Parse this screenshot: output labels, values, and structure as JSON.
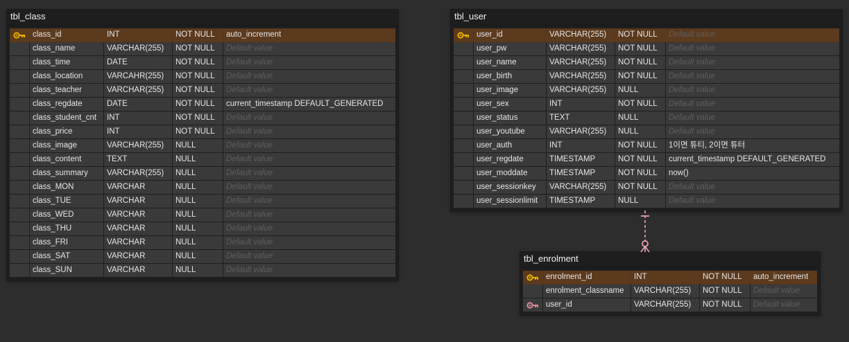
{
  "colors": {
    "background": "#2d2d2d",
    "table_bg": "#1e1e1e",
    "cell_bg": "#3a3a3a",
    "pk_row": "#5c3a1e",
    "pk_key": "#e5b100",
    "fk_key": "#d98a9a",
    "relation_line": "#e8a2b2",
    "placeholder_text": "#5e5e5e"
  },
  "tables": [
    {
      "name": "tbl_class",
      "columns": [
        {
          "name": "class_id",
          "type": "INT",
          "null": "NOT NULL",
          "default": "auto_increment",
          "key": "pk-key-icon"
        },
        {
          "name": "class_name",
          "type": "VARCHAR(255)",
          "null": "NOT NULL",
          "default": "Default value"
        },
        {
          "name": "class_time",
          "type": "DATE",
          "null": "NOT NULL",
          "default": "Default value"
        },
        {
          "name": "class_location",
          "type": "VARCAHR(255)",
          "null": "NOT NULL",
          "default": "Default value"
        },
        {
          "name": "class_teacher",
          "type": "VARCHAR(255)",
          "null": "NOT NULL",
          "default": "Default value"
        },
        {
          "name": "class_regdate",
          "type": "DATE",
          "null": "NOT NULL",
          "default": "current_timestamp DEFAULT_GENERATED"
        },
        {
          "name": "class_student_cnt",
          "type": "INT",
          "null": "NOT NULL",
          "default": "Default value"
        },
        {
          "name": "class_price",
          "type": "INT",
          "null": "NOT NULL",
          "default": "Default value"
        },
        {
          "name": "class_image",
          "type": "VARCHAR(255)",
          "null": "NULL",
          "default": "Default value"
        },
        {
          "name": "class_content",
          "type": "TEXT",
          "null": "NULL",
          "default": "Default value"
        },
        {
          "name": "class_summary",
          "type": "VARCHAR(255)",
          "null": "NULL",
          "default": "Default value"
        },
        {
          "name": "class_MON",
          "type": "VARCHAR",
          "null": "NULL",
          "default": "Default value"
        },
        {
          "name": "class_TUE",
          "type": "VARCHAR",
          "null": "NULL",
          "default": "Default value"
        },
        {
          "name": "class_WED",
          "type": "VARCHAR",
          "null": "NULL",
          "default": "Default value"
        },
        {
          "name": "class_THU",
          "type": "VARCHAR",
          "null": "NULL",
          "default": "Default value"
        },
        {
          "name": "class_FRI",
          "type": "VARCHAR",
          "null": "NULL",
          "default": "Default value"
        },
        {
          "name": "class_SAT",
          "type": "VARCHAR",
          "null": "NULL",
          "default": "Default value"
        },
        {
          "name": "class_SUN",
          "type": "VARCHAR",
          "null": "NULL",
          "default": "Default value"
        }
      ]
    },
    {
      "name": "tbl_user",
      "columns": [
        {
          "name": "user_id",
          "type": "VARCHAR(255)",
          "null": "NOT NULL",
          "default": "Default value",
          "key": "pk-key-icon"
        },
        {
          "name": "user_pw",
          "type": "VARCHAR(255)",
          "null": "NOT NULL",
          "default": "Default value"
        },
        {
          "name": "user_name",
          "type": "VARCHAR(255)",
          "null": "NOT NULL",
          "default": "Default value"
        },
        {
          "name": "user_birth",
          "type": "VARCHAR(255)",
          "null": "NOT NULL",
          "default": "Default value"
        },
        {
          "name": "user_image",
          "type": "VARCHAR(255)",
          "null": "NULL",
          "default": "Default value"
        },
        {
          "name": "user_sex",
          "type": "INT",
          "null": "NOT NULL",
          "default": "Default value"
        },
        {
          "name": "user_status",
          "type": "TEXT",
          "null": "NULL",
          "default": "Default value"
        },
        {
          "name": "user_youtube",
          "type": "VARCHAR(255)",
          "null": "NULL",
          "default": "Default value"
        },
        {
          "name": "user_auth",
          "type": "INT",
          "null": "NOT NULL",
          "default": "1이면 튜티, 2이면 튜터"
        },
        {
          "name": "user_regdate",
          "type": "TIMESTAMP",
          "null": "NOT NULL",
          "default": "current_timestamp DEFAULT_GENERATED"
        },
        {
          "name": "user_moddate",
          "type": "TIMESTAMP",
          "null": "NOT NULL",
          "default": "now()"
        },
        {
          "name": "user_sessionkey",
          "type": "VARCHAR(255)",
          "null": "NOT NULL",
          "default": "Default value"
        },
        {
          "name": "user_sessionlimit",
          "type": "TIMESTAMP",
          "null": "NULL",
          "default": "Default value"
        }
      ]
    },
    {
      "name": "tbl_enrolment",
      "columns": [
        {
          "name": "enrolment_id",
          "type": "INT",
          "null": "NOT NULL",
          "default": "auto_increment",
          "key": "pk-key-icon"
        },
        {
          "name": "enrolment_classname",
          "type": "VARCHAR(255)",
          "null": "NOT NULL",
          "default": "Default value"
        },
        {
          "name": "user_id",
          "type": "VARCHAR(255)",
          "null": "NOT NULL",
          "default": "Default value",
          "key": "fk-key-icon"
        }
      ]
    }
  ],
  "relations": [
    {
      "from": "tbl_user.user_id",
      "to": "tbl_enrolment.user_id",
      "from_cardinality": "one",
      "to_cardinality": "zero-or-many"
    }
  ]
}
